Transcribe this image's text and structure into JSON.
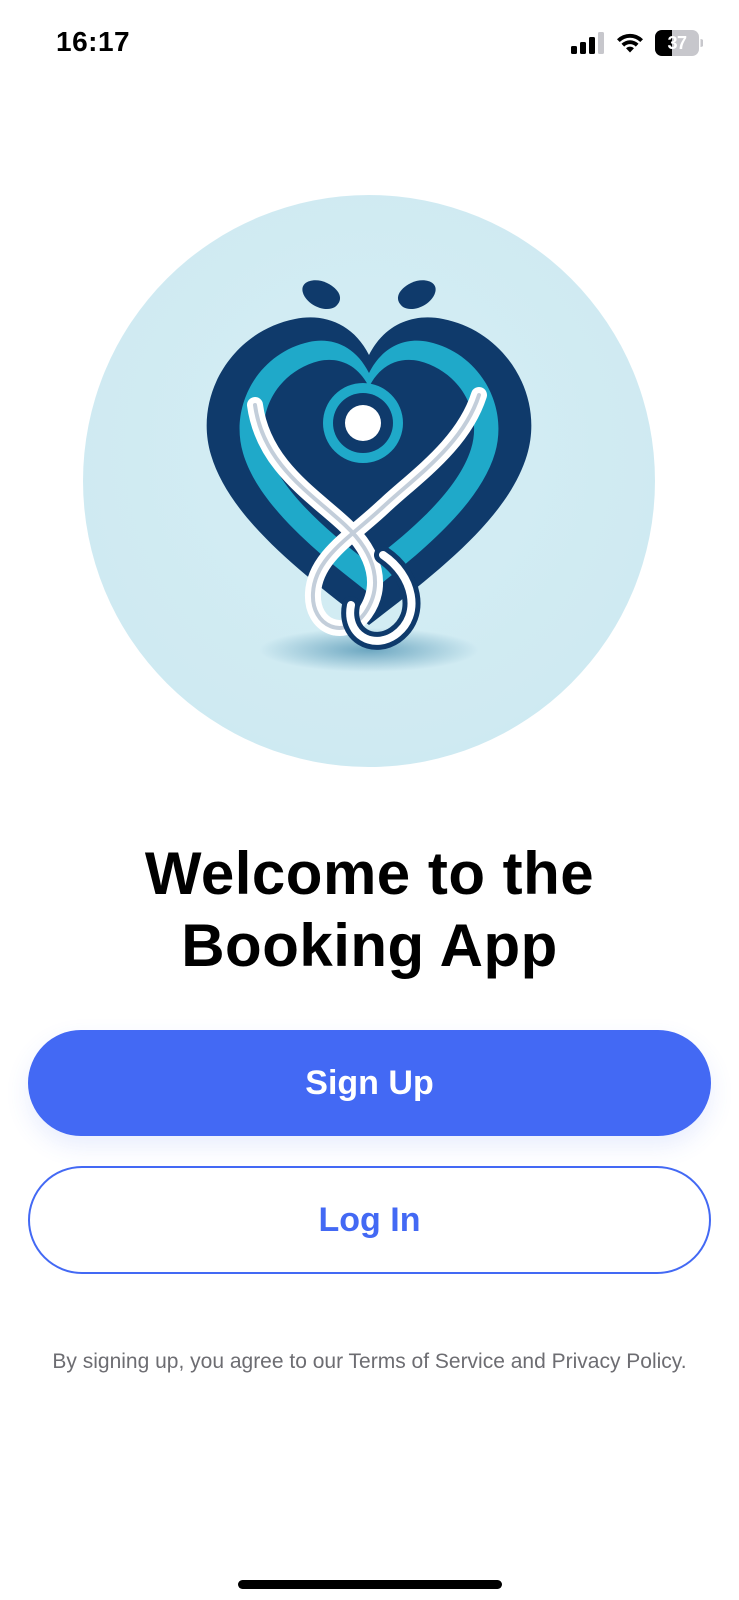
{
  "status_bar": {
    "time": "16:17",
    "battery_level": "37",
    "icons": [
      "signal-icon",
      "wifi-icon",
      "battery-icon"
    ]
  },
  "logo": {
    "icon": "heart-stethoscope-logo",
    "colors": {
      "circle": "#cfeaf2",
      "navy": "#0f3a6b",
      "teal": "#1fa9c9",
      "white": "#ffffff"
    }
  },
  "welcome": {
    "title_line1": "Welcome to the",
    "title_line2": "Booking App"
  },
  "buttons": {
    "signup_label": "Sign Up",
    "login_label": "Log In"
  },
  "terms": {
    "text": "By signing up, you agree to our Terms of Service and Privacy Policy."
  },
  "colors": {
    "accent": "#4369f4",
    "muted_text": "#6d6d72"
  }
}
